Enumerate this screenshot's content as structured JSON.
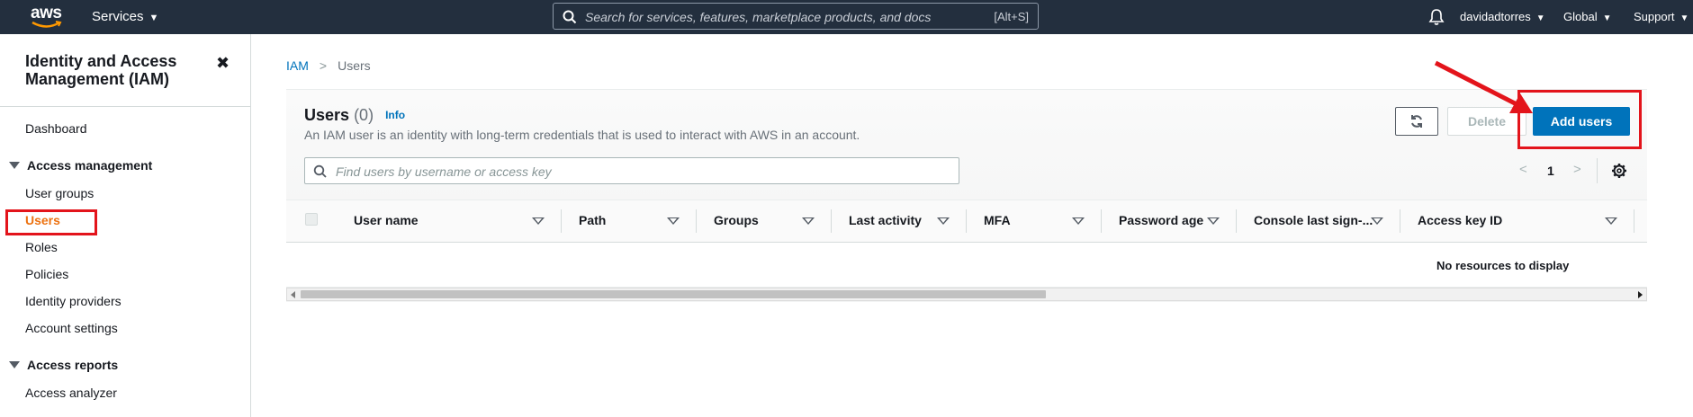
{
  "topnav": {
    "logo_text": "aws",
    "services_label": "Services",
    "search_placeholder": "Search for services, features, marketplace products, and docs",
    "search_shortcut": "[Alt+S]",
    "account": "davidadtorres",
    "region": "Global",
    "support": "Support"
  },
  "sidebar": {
    "title": "Identity and Access Management (IAM)",
    "close": "✖",
    "dashboard": "Dashboard",
    "section_access_management": "Access management",
    "items": [
      "User groups",
      "Users",
      "Roles",
      "Policies",
      "Identity providers",
      "Account settings"
    ],
    "active_item": "Users",
    "section_access_reports": "Access reports",
    "reports_items": [
      "Access analyzer"
    ]
  },
  "breadcrumb": {
    "root": "IAM",
    "current": "Users"
  },
  "panel": {
    "title": "Users",
    "count": "(0)",
    "info": "Info",
    "description": "An IAM user is an identity with long-term credentials that is used to interact with AWS in an account.",
    "delete_label": "Delete",
    "add_label": "Add users",
    "filter_placeholder": "Find users by username or access key",
    "page": "1"
  },
  "table": {
    "columns": [
      "User name",
      "Path",
      "Groups",
      "Last activity",
      "MFA",
      "Password age",
      "Console last sign-...",
      "Access key ID"
    ],
    "empty_text": "No resources to display"
  },
  "colors": {
    "nav_bg": "#232f3e",
    "primary": "#0073bb",
    "annotation_red": "#e3141b",
    "active_orange": "#ec7211"
  }
}
